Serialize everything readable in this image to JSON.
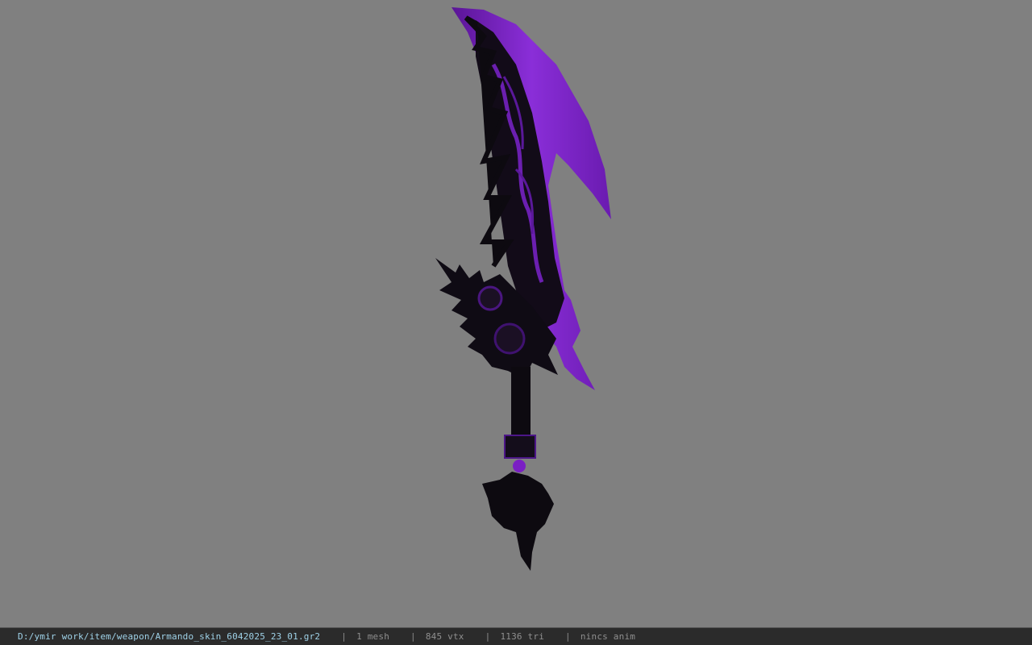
{
  "viewport": {
    "background_color": "#808080",
    "model": {
      "name": "weapon-model",
      "accent_color": "#7a1fc4",
      "dark_color": "#0d0a10"
    }
  },
  "statusbar": {
    "file_path": "D:/ymir work/item/weapon/Armando_skin_6042025_23_01.gr2",
    "separator": "|",
    "mesh_count": "1 mesh",
    "vertex_count": "845 vtx",
    "triangle_count": "1136 tri",
    "anim_status": "nincs anim"
  }
}
